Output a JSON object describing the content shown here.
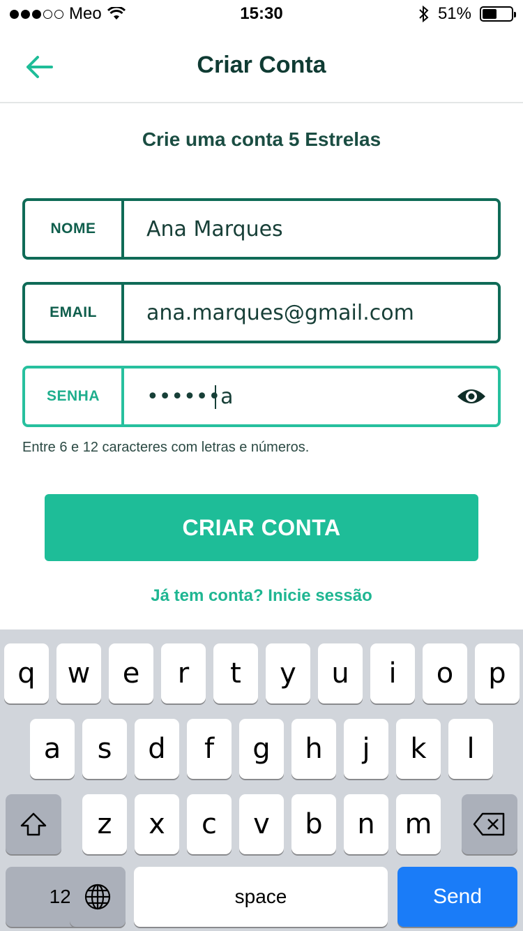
{
  "status_bar": {
    "carrier": "Meo",
    "time": "15:30",
    "battery_percent": "51%",
    "battery_level": 0.51
  },
  "header": {
    "title": "Criar Conta",
    "back_icon": "arrow-left-icon"
  },
  "subtitle": "Crie uma conta 5 Estrelas",
  "form": {
    "name": {
      "label": "NOME",
      "value": "Ana Marques"
    },
    "email": {
      "label": "EMAIL",
      "value": "ana.marques@gmail.com"
    },
    "password": {
      "label": "SENHA",
      "value": "••••••a",
      "toggle_icon": "eye-icon"
    },
    "hint": "Entre 6 e 12 caracteres com letras e números."
  },
  "submit_label": "CRIAR CONTA",
  "login_link": "Já tem conta? Inicie sessão",
  "keyboard": {
    "row1": [
      "q",
      "w",
      "e",
      "r",
      "t",
      "y",
      "u",
      "i",
      "o",
      "p"
    ],
    "row2": [
      "a",
      "s",
      "d",
      "f",
      "g",
      "h",
      "j",
      "k",
      "l"
    ],
    "row3": [
      "z",
      "x",
      "c",
      "v",
      "b",
      "n",
      "m"
    ],
    "numbers_label": "123",
    "space_label": "space",
    "send_label": "Send"
  },
  "colors": {
    "accent": "#1ebd98",
    "field_border": "#0f6b57",
    "send_key": "#1a7cf8"
  }
}
